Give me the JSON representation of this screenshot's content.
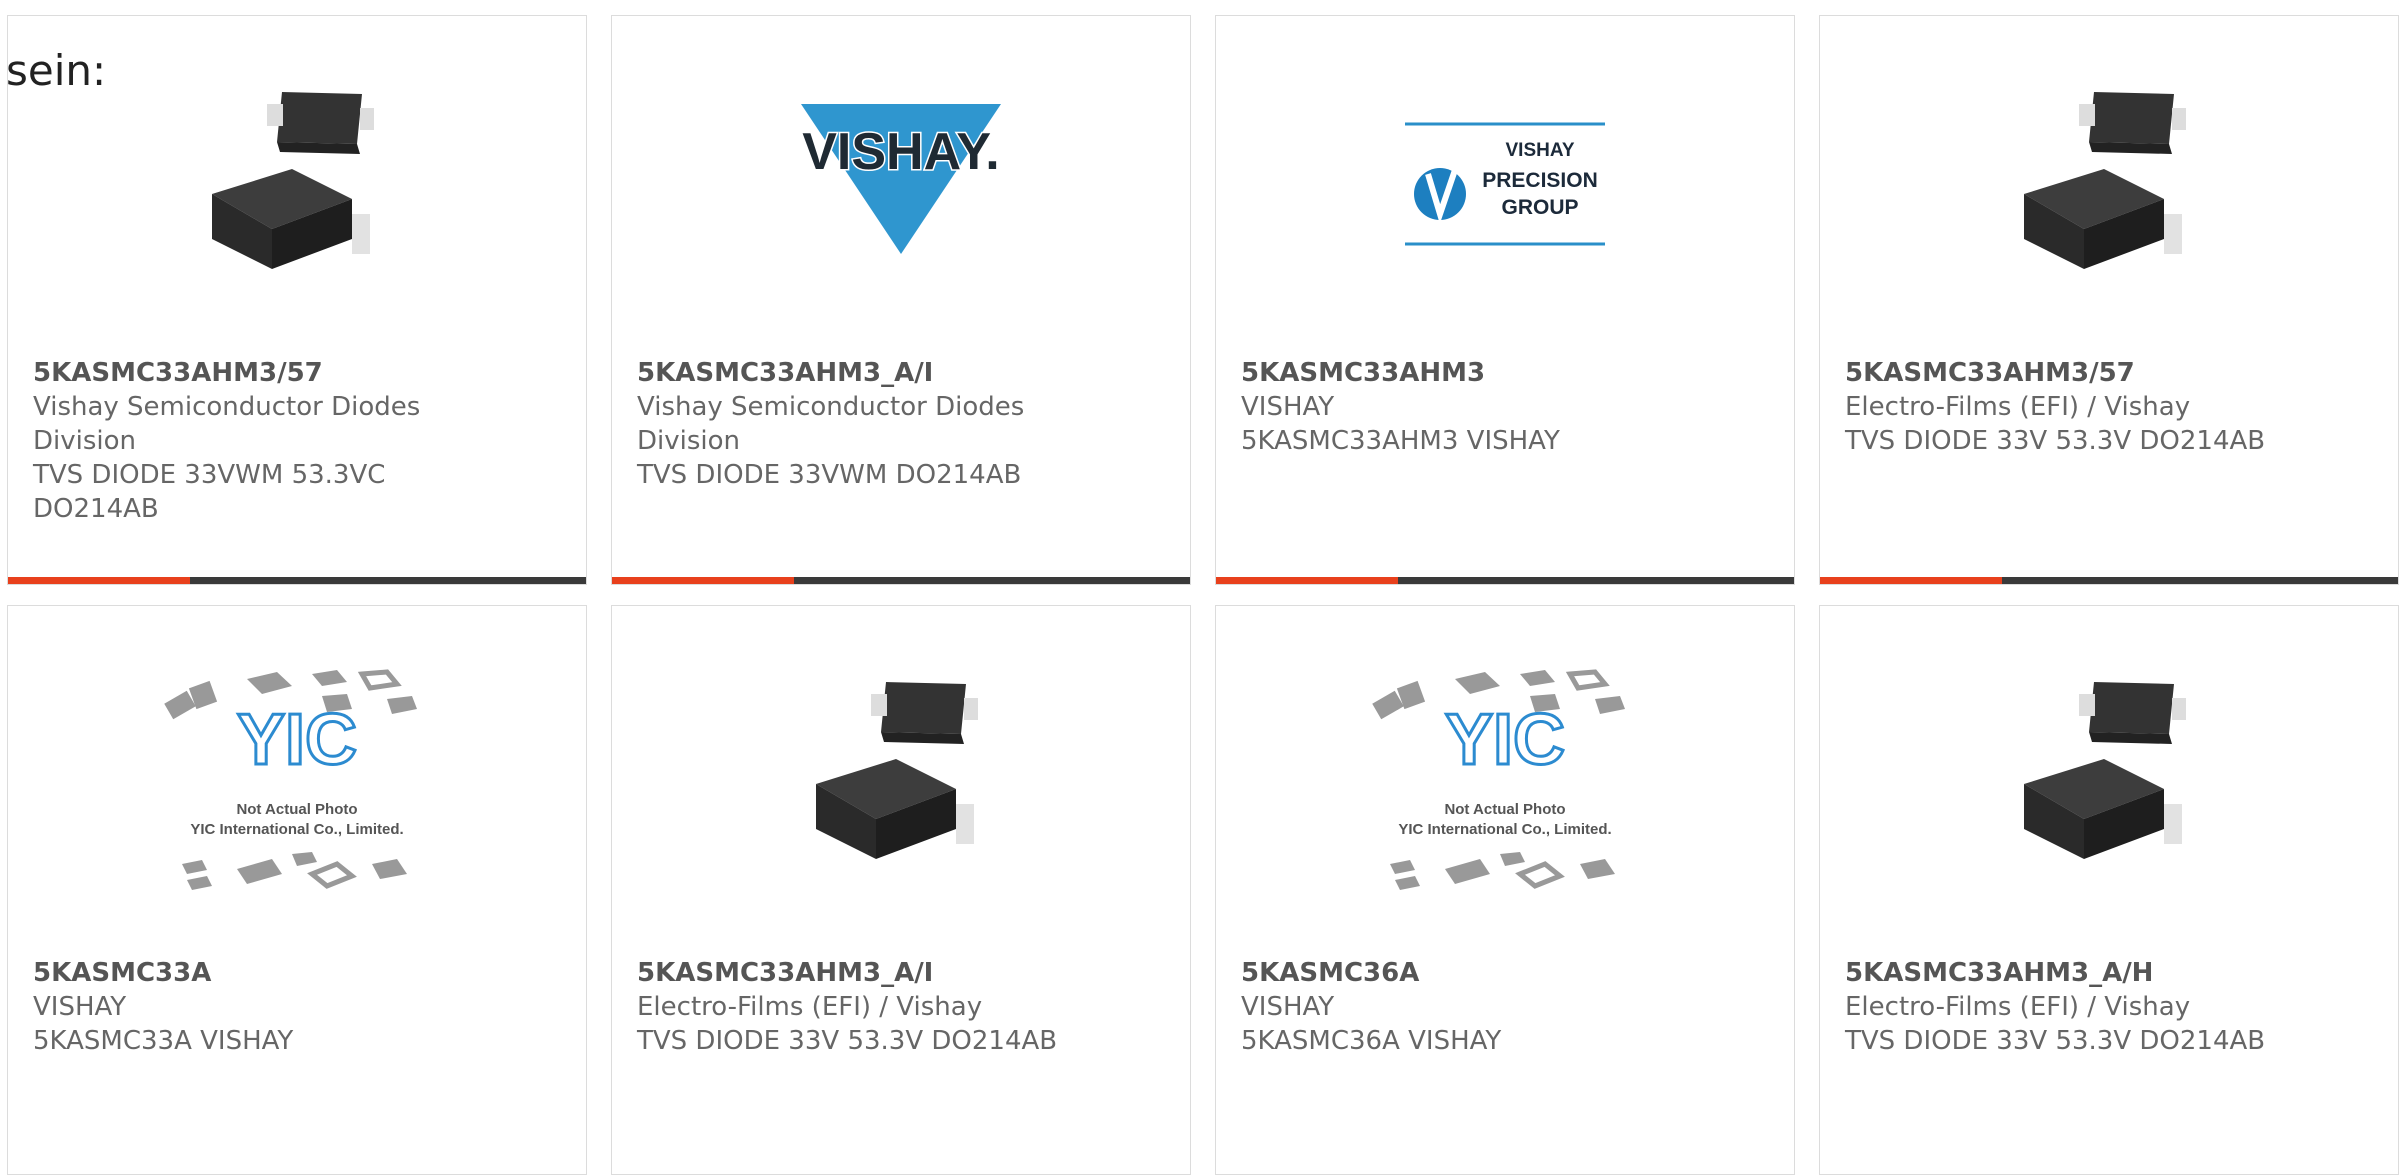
{
  "lead_text": "sein:",
  "colors": {
    "accent": "#e8401c",
    "bar": "#3a3a3a",
    "title": "#555555",
    "text": "#666666"
  },
  "cards": [
    {
      "part": "5KASMC33AHM3/57",
      "lines": [
        "Vishay Semiconductor Diodes",
        "Division",
        "TVS DIODE 33VWM 53.3VC",
        "DO214AB"
      ],
      "image": "diode-package"
    },
    {
      "part": "5KASMC33AHM3_A/I",
      "lines": [
        "Vishay Semiconductor Diodes",
        "Division",
        "TVS DIODE 33VWM DO214AB"
      ],
      "image": "vishay-logo",
      "logo_text": "VISHAY."
    },
    {
      "part": "5KASMC33AHM3",
      "lines": [
        "VISHAY",
        "5KASMC33AHM3 VISHAY"
      ],
      "image": "vpg-logo",
      "logo_text": [
        "VISHAY",
        "PRECISION",
        "GROUP"
      ]
    },
    {
      "part": "5KASMC33AHM3/57",
      "lines": [
        "Electro-Films (EFI) / Vishay",
        "TVS DIODE 33V 53.3V DO214AB"
      ],
      "image": "diode-package"
    },
    {
      "part": "5KASMC33A",
      "lines": [
        "VISHAY",
        "5KASMC33A VISHAY"
      ],
      "image": "yic-placeholder",
      "photo_text": [
        "Not Actual Photo",
        "YIC International Co., Limited."
      ]
    },
    {
      "part": "5KASMC33AHM3_A/I",
      "lines": [
        "Electro-Films (EFI) / Vishay",
        "TVS DIODE 33V 53.3V DO214AB"
      ],
      "image": "diode-package"
    },
    {
      "part": "5KASMC36A",
      "lines": [
        "VISHAY",
        "5KASMC36A VISHAY"
      ],
      "image": "yic-placeholder",
      "photo_text": [
        "Not Actual Photo",
        "YIC International Co., Limited."
      ]
    },
    {
      "part": "5KASMC33AHM3_A/H",
      "lines": [
        "Electro-Films (EFI) / Vishay",
        "TVS DIODE 33V 53.3V DO214AB"
      ],
      "image": "diode-package"
    }
  ]
}
